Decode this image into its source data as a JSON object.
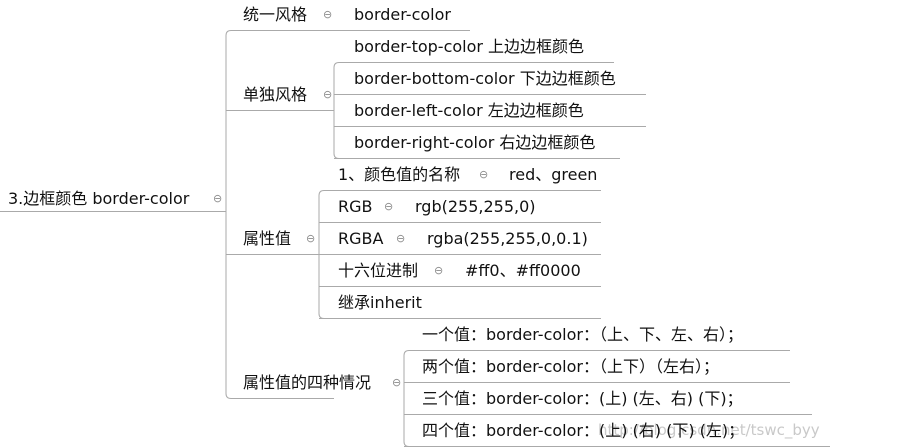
{
  "colors": {
    "line": "#aaaaaa",
    "text": "#111111",
    "toggle": "#8a8a8a",
    "watermark": "#c9c9c9"
  },
  "toggle_glyph": "⊖",
  "root": {
    "label": "3.边框颜色 border-color"
  },
  "branches": {
    "unified": {
      "label": "统一风格",
      "value": "border-color"
    },
    "individual": {
      "label": "单独风格",
      "items": [
        "border-top-color 上边边框颜色",
        "border-bottom-color 下边边框颜色",
        "border-left-color 左边边框颜色",
        "border-right-color 右边边框颜色"
      ]
    },
    "values": {
      "label": "属性值",
      "named": {
        "label": "1、颜色值的名称",
        "value": "red、green"
      },
      "rgb": {
        "label": "RGB",
        "value": "rgb(255,255,0)"
      },
      "rgba": {
        "label": "RGBA",
        "value": "rgba(255,255,0,0.1)"
      },
      "hex": {
        "label": "十六位进制",
        "value": "#ff0、#ff0000"
      },
      "inherit": {
        "label": "继承inherit"
      }
    },
    "four_cases": {
      "label": "属性值的四种情况",
      "items": [
        "一个值：border-color：（上、下、左、右）；",
        "两个值：border-color：（上下）（左右）；",
        "三个值：border-color：(上) (左、右) (下)；",
        "四个值：border-color：(上) (右) (下) (左)；"
      ]
    }
  },
  "watermark": "http://blog.csdn.net/tswc_byy"
}
